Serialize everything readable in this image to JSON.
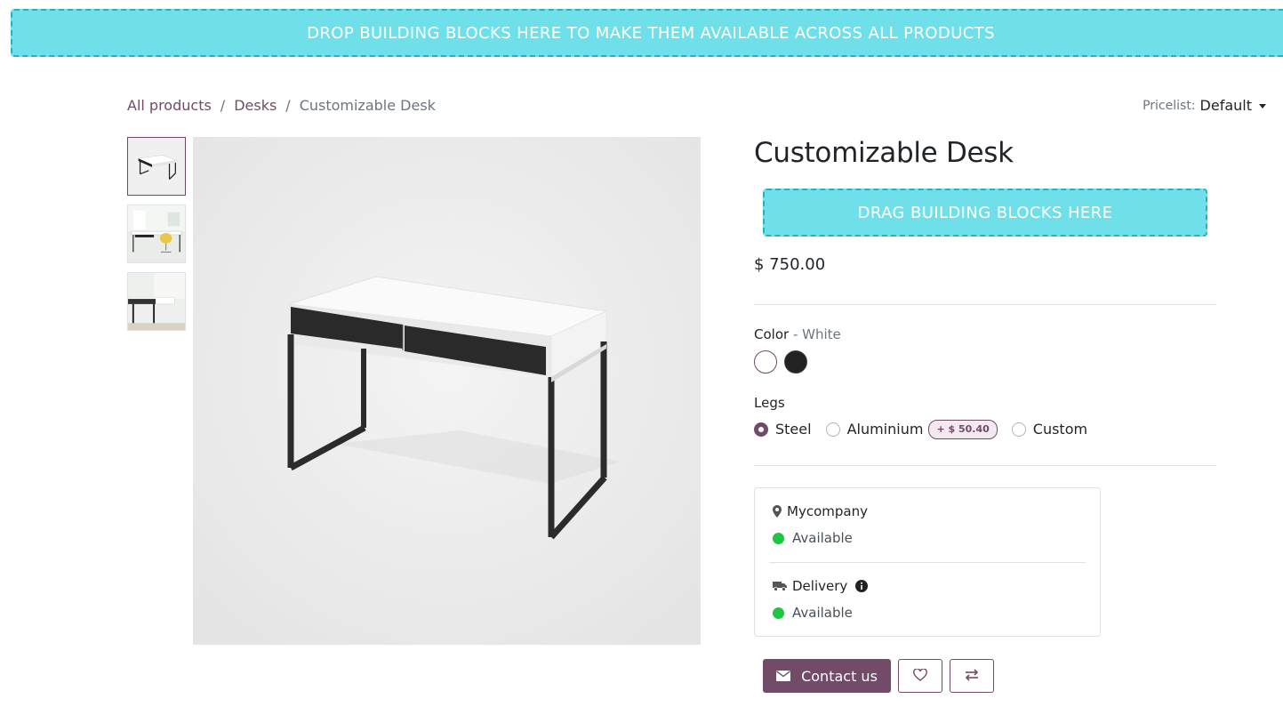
{
  "dropzones": {
    "global": "DROP BUILDING BLOCKS HERE TO MAKE THEM AVAILABLE ACROSS ALL PRODUCTS",
    "product": "DRAG BUILDING BLOCKS HERE"
  },
  "breadcrumb": {
    "items": [
      {
        "label": "All products"
      },
      {
        "label": "Desks"
      },
      {
        "label": "Customizable Desk"
      }
    ],
    "separator": "/"
  },
  "pricelist": {
    "label": "Pricelist:",
    "value": "Default"
  },
  "gallery": {
    "thumbnails": [
      "thumbnail-desk-white",
      "thumbnail-desk-office",
      "thumbnail-desk-closeup"
    ],
    "active_index": 0
  },
  "product": {
    "title": "Customizable Desk",
    "price": "$ 750.00"
  },
  "attributes": {
    "color": {
      "label": "Color",
      "separator": " - ",
      "selected": "White",
      "swatches": [
        {
          "name": "White",
          "hex": "#ffffff",
          "selected": true
        },
        {
          "name": "Black",
          "hex": "#222222",
          "selected": false
        }
      ]
    },
    "legs": {
      "label": "Legs",
      "options": [
        {
          "label": "Steel",
          "checked": true
        },
        {
          "label": "Aluminium",
          "checked": false,
          "extra": "+ $ 50.40"
        },
        {
          "label": "Custom",
          "checked": false
        }
      ]
    }
  },
  "availability": {
    "warehouse": {
      "name": "Mycompany",
      "status": "Available"
    },
    "delivery": {
      "name": "Delivery",
      "status": "Available"
    }
  },
  "actions": {
    "contact_label": "Contact us"
  },
  "colors": {
    "accent": "#714b67",
    "dropzone": "#6fe0ea",
    "available": "#1bc840"
  },
  "icons": {
    "contact": "envelope-icon",
    "wishlist": "heart-icon",
    "compare": "exchange-icon",
    "location": "map-marker-icon",
    "delivery": "truck-icon",
    "info": "info-circle-icon"
  }
}
